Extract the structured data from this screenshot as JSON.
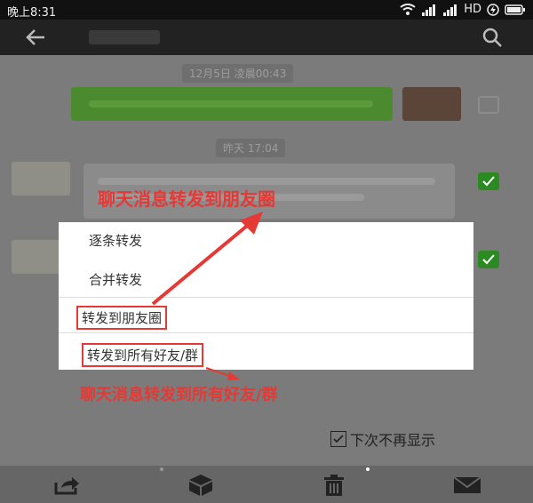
{
  "status_bar": {
    "time": "晚上8:31",
    "network": "HD"
  },
  "chat": {
    "timestamp1": "12月5日 凌晨00:43",
    "timestamp2": "昨天 17:04"
  },
  "popup": {
    "items": [
      "逐条转发",
      "合并转发",
      "转发到朋友圈",
      "转发到所有好友/群"
    ],
    "dont_show_label": "下次不再显示"
  },
  "annotations": {
    "top": "聊天消息转发到朋友圈",
    "bottom": "聊天消息转发到所有好友/群"
  },
  "colors": {
    "annotation_red": "#e53935",
    "check_green": "#2c8a22"
  }
}
